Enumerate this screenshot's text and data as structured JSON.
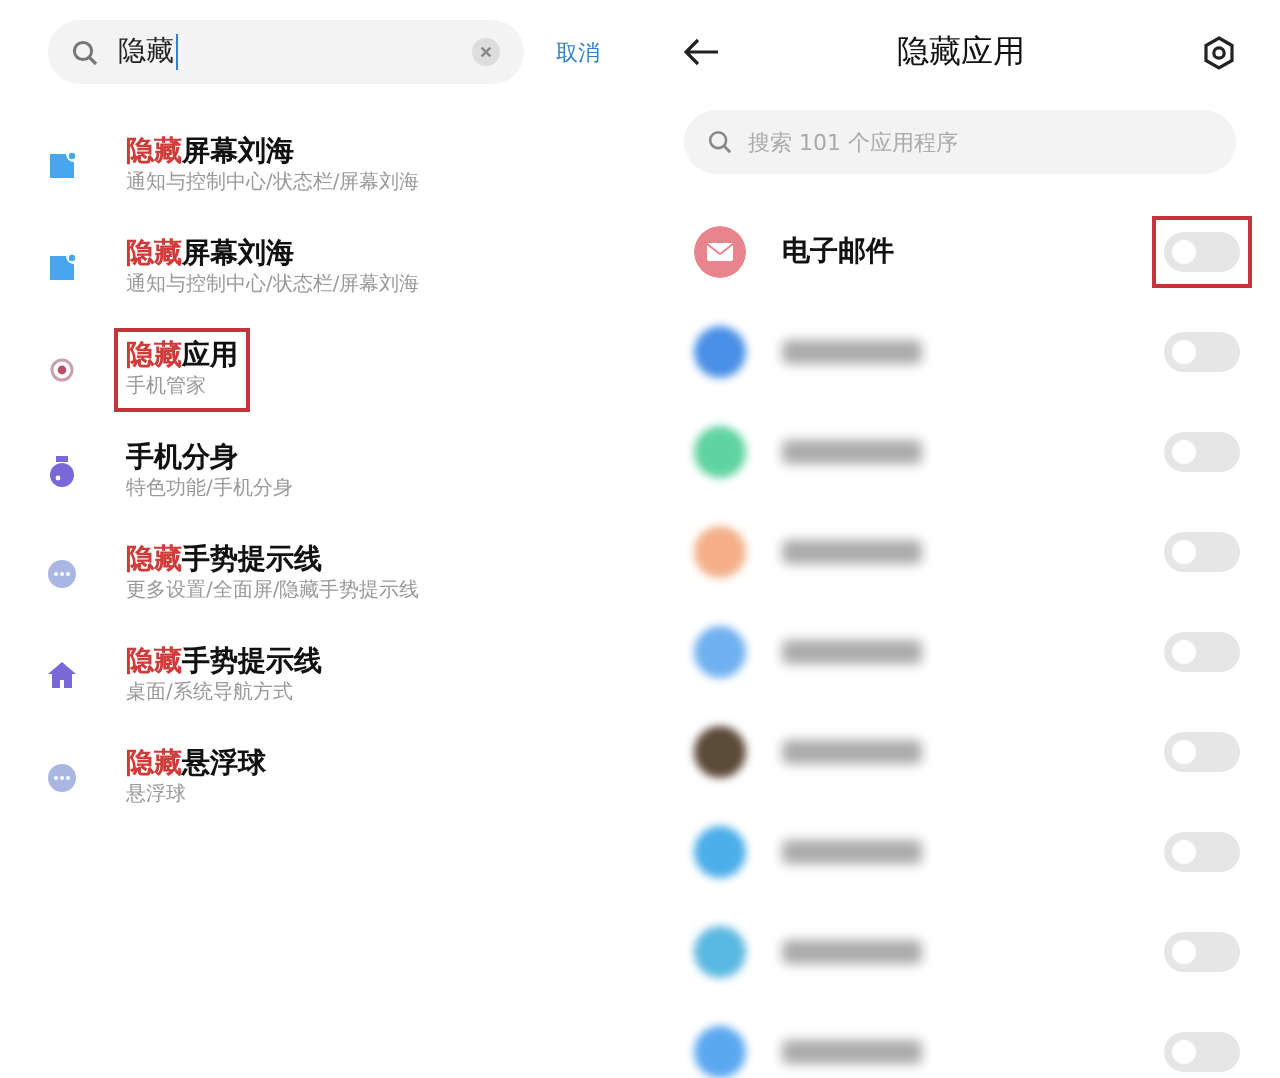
{
  "search_screen": {
    "search": {
      "value": "隐藏"
    },
    "cancel": "取消",
    "results": [
      {
        "kind": "notch",
        "match": "隐藏",
        "title": "屏幕刘海",
        "path": "通知与控制中心/状态栏/屏幕刘海",
        "annotated": false
      },
      {
        "kind": "notch",
        "match": "隐藏",
        "title": "屏幕刘海",
        "path": "通知与控制中心/状态栏/屏幕刘海",
        "annotated": false
      },
      {
        "kind": "target",
        "match": "隐藏",
        "title": "应用",
        "path": "手机管家",
        "annotated": true
      },
      {
        "kind": "clone",
        "title": "手机分身",
        "path": "特色功能/手机分身",
        "annotated": false
      },
      {
        "kind": "more",
        "match": "隐藏",
        "title": "手势提示线",
        "path": "更多设置/全面屏/隐藏手势提示线",
        "annotated": false
      },
      {
        "kind": "home",
        "match": "隐藏",
        "title": "手势提示线",
        "path": "桌面/系统导航方式",
        "annotated": false
      },
      {
        "kind": "more",
        "match": "隐藏",
        "title": "悬浮球",
        "path": "悬浮球",
        "annotated": false
      }
    ]
  },
  "hidden_apps_screen": {
    "title": "隐藏应用",
    "search": {
      "placeholder": "搜索 101 个应用程序"
    },
    "apps": [
      {
        "kind": "mail",
        "name": "电子邮件",
        "on": false,
        "annotated": true
      },
      {
        "kind": "blurred",
        "color": "#4a90e8",
        "on": false,
        "annotated": false
      },
      {
        "kind": "blurred",
        "color": "#5fd3a0",
        "on": false,
        "annotated": false
      },
      {
        "kind": "blurred",
        "color": "#f5b08a",
        "on": false,
        "annotated": false
      },
      {
        "kind": "blurred",
        "color": "#6fb0f0",
        "on": false,
        "annotated": false
      },
      {
        "kind": "blurred",
        "color": "#5a4a38",
        "on": false,
        "annotated": false
      },
      {
        "kind": "blurred",
        "color": "#4aaee8",
        "on": false,
        "annotated": false
      },
      {
        "kind": "blurred",
        "color": "#5ab8e0",
        "on": false,
        "annotated": false
      },
      {
        "kind": "blurred",
        "color": "#5aa8f0",
        "on": false,
        "annotated": false
      }
    ]
  }
}
